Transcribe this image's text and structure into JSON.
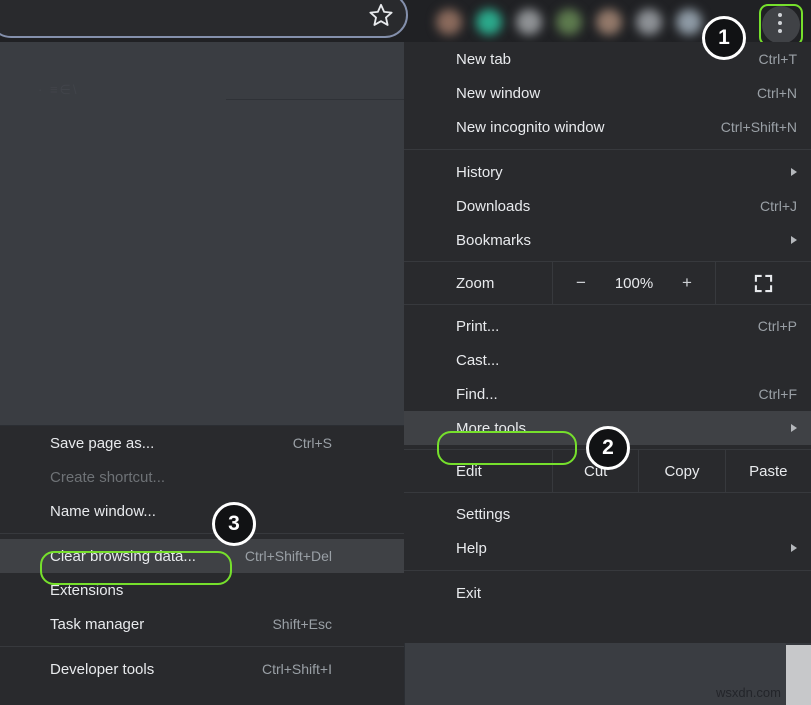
{
  "toolbar": {
    "star_icon": "bookmark-star-icon",
    "kebab_icon": "three-dot-menu-icon",
    "extension_colors": [
      "#8a6a5c",
      "#2ba98b",
      "#8f9295",
      "#5d7a4e",
      "#93796a",
      "#8d9196",
      "#8e9aa5"
    ]
  },
  "main_menu": {
    "items": [
      {
        "label": "New tab",
        "accel": "Ctrl+T",
        "submenu": false
      },
      {
        "label": "New window",
        "accel": "Ctrl+N",
        "submenu": false
      },
      {
        "label": "New incognito window",
        "accel": "Ctrl+Shift+N",
        "submenu": false
      },
      {
        "label": "History",
        "accel": "",
        "submenu": true
      },
      {
        "label": "Downloads",
        "accel": "Ctrl+J",
        "submenu": false
      },
      {
        "label": "Bookmarks",
        "accel": "",
        "submenu": true
      },
      {
        "label": "Print...",
        "accel": "Ctrl+P",
        "submenu": false
      },
      {
        "label": "Cast...",
        "accel": "",
        "submenu": false
      },
      {
        "label": "Find...",
        "accel": "Ctrl+F",
        "submenu": false
      },
      {
        "label": "More tools",
        "accel": "",
        "submenu": true
      },
      {
        "label": "Settings",
        "accel": "",
        "submenu": false
      },
      {
        "label": "Help",
        "accel": "",
        "submenu": true
      },
      {
        "label": "Exit",
        "accel": "",
        "submenu": false
      }
    ],
    "zoom_row": {
      "label": "Zoom",
      "minus": "−",
      "percent": "100%",
      "plus": "+",
      "fullscreen_icon": "fullscreen-icon"
    },
    "edit_row": {
      "label": "Edit",
      "cut": "Cut",
      "copy": "Copy",
      "paste": "Paste"
    }
  },
  "sub_menu": {
    "items": [
      {
        "label": "Save page as...",
        "accel": "Ctrl+S",
        "disabled": false,
        "highlighted": false
      },
      {
        "label": "Create shortcut...",
        "accel": "",
        "disabled": true,
        "highlighted": false
      },
      {
        "label": "Name window...",
        "accel": "",
        "disabled": false,
        "highlighted": false
      },
      {
        "label": "Clear browsing data...",
        "accel": "Ctrl+Shift+Del",
        "disabled": false,
        "highlighted": true
      },
      {
        "label": "Extensions",
        "accel": "",
        "disabled": false,
        "highlighted": false
      },
      {
        "label": "Task manager",
        "accel": "Shift+Esc",
        "disabled": false,
        "highlighted": false
      },
      {
        "label": "Developer tools",
        "accel": "Ctrl+Shift+I",
        "disabled": false,
        "highlighted": false
      }
    ]
  },
  "annotations": {
    "badges": [
      {
        "number": "1",
        "target": "three-dot-menu-button"
      },
      {
        "number": "2",
        "target": "more-tools-menu-item"
      },
      {
        "number": "3",
        "target": "clear-browsing-data-menu-item"
      }
    ],
    "highlight_color": "#76e02c"
  },
  "watermark": {
    "text": "wsxdn.com"
  },
  "page": {
    "ghost_text": "· ≡∈\\"
  }
}
